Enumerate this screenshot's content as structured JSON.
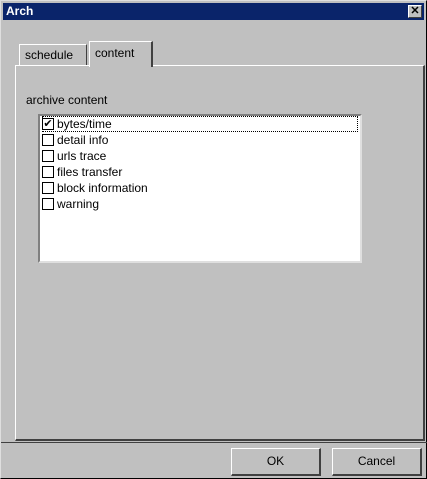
{
  "window": {
    "title": "Arch",
    "close_icon": "close-icon"
  },
  "tabs": [
    {
      "label": "schedule",
      "active": false
    },
    {
      "label": "content",
      "active": true
    }
  ],
  "content": {
    "section_label": "archive content",
    "items": [
      {
        "label": "bytes/time",
        "checked": true
      },
      {
        "label": "detail info",
        "checked": false
      },
      {
        "label": "urls trace",
        "checked": false
      },
      {
        "label": "files transfer",
        "checked": false
      },
      {
        "label": "block information",
        "checked": false
      },
      {
        "label": "warning",
        "checked": false
      }
    ]
  },
  "buttons": {
    "ok_label": "OK",
    "cancel_label": "Cancel"
  }
}
